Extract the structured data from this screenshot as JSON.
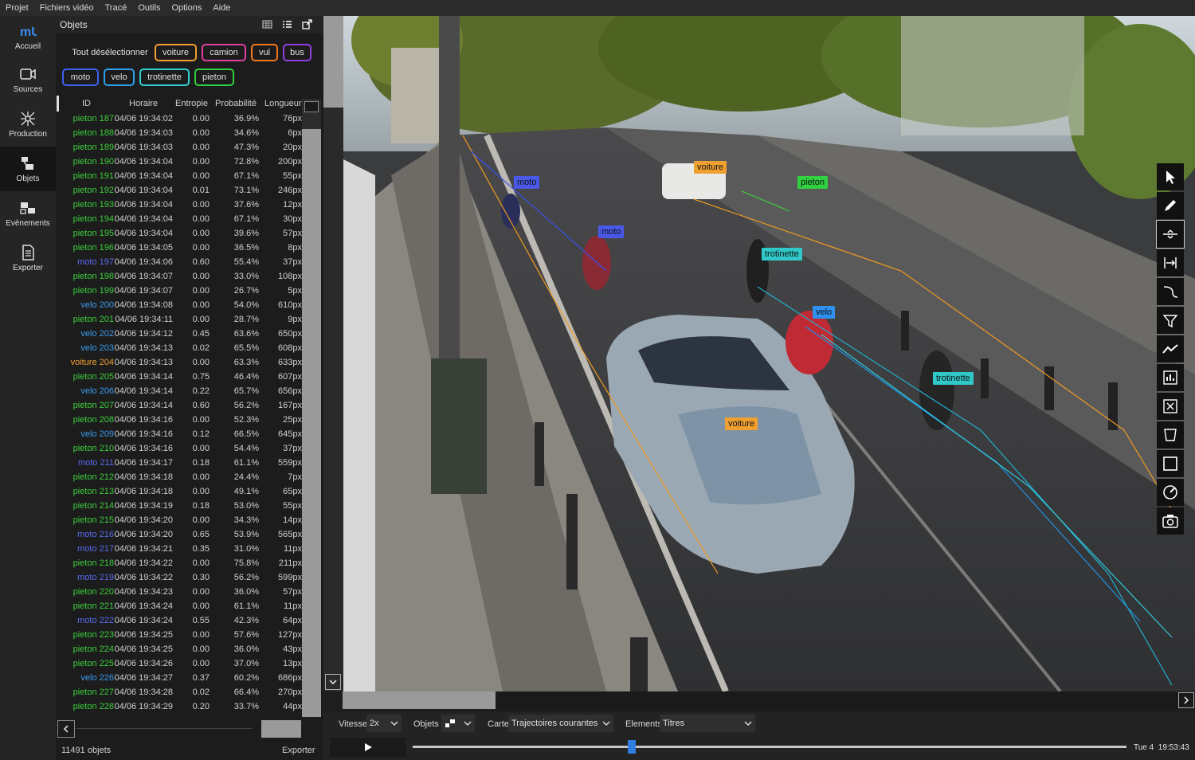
{
  "menu": [
    "Projet",
    "Fichiers vidéo",
    "Tracé",
    "Outils",
    "Options",
    "Aide"
  ],
  "nav": [
    {
      "label": "Accueil",
      "icon": "mu-logo-icon"
    },
    {
      "label": "Sources",
      "icon": "camera-icon"
    },
    {
      "label": "Production",
      "icon": "network-icon"
    },
    {
      "label": "Objets",
      "icon": "objects-icon"
    },
    {
      "label": "Evènements",
      "icon": "events-icon"
    },
    {
      "label": "Exporter",
      "icon": "document-icon"
    }
  ],
  "panel": {
    "title": "Objets",
    "deselect": "Tout désélectionner",
    "footer_count": "11491 objets",
    "export": "Exporter"
  },
  "filters": [
    {
      "label": "voiture",
      "color": "#f0a030"
    },
    {
      "label": "camion",
      "color": "#e040a0"
    },
    {
      "label": "vul",
      "color": "#f07820"
    },
    {
      "label": "bus",
      "color": "#9040e0"
    },
    {
      "label": "moto",
      "color": "#4060f0"
    },
    {
      "label": "velo",
      "color": "#30a0f0"
    },
    {
      "label": "trotinette",
      "color": "#30d0d0"
    },
    {
      "label": "pieton",
      "color": "#30d040"
    }
  ],
  "columns": [
    "ID",
    "Horaire",
    "Entropie",
    "Probabilité",
    "Longueur"
  ],
  "type_colors": {
    "pieton": "#3ccf3c",
    "moto": "#5a6cf0",
    "velo": "#3a9cf0",
    "voiture": "#f0a030"
  },
  "rows": [
    [
      "pieton 187",
      "04/06 19:34:02",
      "0.00",
      "36.9%",
      "76px"
    ],
    [
      "pieton 188",
      "04/06 19:34:03",
      "0.00",
      "34.6%",
      "6px"
    ],
    [
      "pieton 189",
      "04/06 19:34:03",
      "0.00",
      "47.3%",
      "20px"
    ],
    [
      "pieton 190",
      "04/06 19:34:04",
      "0.00",
      "72.8%",
      "200px"
    ],
    [
      "pieton 191",
      "04/06 19:34:04",
      "0.00",
      "67.1%",
      "55px"
    ],
    [
      "pieton 192",
      "04/06 19:34:04",
      "0.01",
      "73.1%",
      "246px"
    ],
    [
      "pieton 193",
      "04/06 19:34:04",
      "0.00",
      "37.6%",
      "12px"
    ],
    [
      "pieton 194",
      "04/06 19:34:04",
      "0.00",
      "67.1%",
      "30px"
    ],
    [
      "pieton 195",
      "04/06 19:34:04",
      "0.00",
      "39.6%",
      "57px"
    ],
    [
      "pieton 196",
      "04/06 19:34:05",
      "0.00",
      "36.5%",
      "8px"
    ],
    [
      "moto 197",
      "04/06 19:34:06",
      "0.60",
      "55.4%",
      "37px"
    ],
    [
      "pieton 198",
      "04/06 19:34:07",
      "0.00",
      "33.0%",
      "108px"
    ],
    [
      "pieton 199",
      "04/06 19:34:07",
      "0.00",
      "26.7%",
      "5px"
    ],
    [
      "velo 200",
      "04/06 19:34:08",
      "0.00",
      "54.0%",
      "610px"
    ],
    [
      "pieton 201",
      "04/06 19:34:11",
      "0.00",
      "28.7%",
      "9px"
    ],
    [
      "velo 202",
      "04/06 19:34:12",
      "0.45",
      "63.6%",
      "650px"
    ],
    [
      "velo 203",
      "04/06 19:34:13",
      "0.02",
      "65.5%",
      "608px"
    ],
    [
      "voiture 204",
      "04/06 19:34:13",
      "0.00",
      "63.3%",
      "633px"
    ],
    [
      "pieton 205",
      "04/06 19:34:14",
      "0.75",
      "46.4%",
      "607px"
    ],
    [
      "velo 206",
      "04/06 19:34:14",
      "0.22",
      "65.7%",
      "656px"
    ],
    [
      "pieton 207",
      "04/06 19:34:14",
      "0.60",
      "56.2%",
      "167px"
    ],
    [
      "pieton 208",
      "04/06 19:34:16",
      "0.00",
      "52.3%",
      "25px"
    ],
    [
      "velo 209",
      "04/06 19:34:16",
      "0.12",
      "66.5%",
      "645px"
    ],
    [
      "pieton 210",
      "04/06 19:34:16",
      "0.00",
      "54.4%",
      "37px"
    ],
    [
      "moto 211",
      "04/06 19:34:17",
      "0.18",
      "61.1%",
      "559px"
    ],
    [
      "pieton 212",
      "04/06 19:34:18",
      "0.00",
      "24.4%",
      "7px"
    ],
    [
      "pieton 213",
      "04/06 19:34:18",
      "0.00",
      "49.1%",
      "65px"
    ],
    [
      "pieton 214",
      "04/06 19:34:19",
      "0.18",
      "53.0%",
      "55px"
    ],
    [
      "pieton 215",
      "04/06 19:34:20",
      "0.00",
      "34.3%",
      "14px"
    ],
    [
      "moto 216",
      "04/06 19:34:20",
      "0.65",
      "53.9%",
      "565px"
    ],
    [
      "moto 217",
      "04/06 19:34:21",
      "0.35",
      "31.0%",
      "11px"
    ],
    [
      "pieton 218",
      "04/06 19:34:22",
      "0.00",
      "75.8%",
      "211px"
    ],
    [
      "moto 219",
      "04/06 19:34:22",
      "0.30",
      "56.2%",
      "599px"
    ],
    [
      "pieton 220",
      "04/06 19:34:23",
      "0.00",
      "36.0%",
      "57px"
    ],
    [
      "pieton 221",
      "04/06 19:34:24",
      "0.00",
      "61.1%",
      "11px"
    ],
    [
      "moto 222",
      "04/06 19:34:24",
      "0.55",
      "42.3%",
      "64px"
    ],
    [
      "pieton 223",
      "04/06 19:34:25",
      "0.00",
      "57.6%",
      "127px"
    ],
    [
      "pieton 224",
      "04/06 19:34:25",
      "0.00",
      "36.0%",
      "43px"
    ],
    [
      "pieton 225",
      "04/06 19:34:26",
      "0.00",
      "37.0%",
      "13px"
    ],
    [
      "velo 226",
      "04/06 19:34:27",
      "0.37",
      "60.2%",
      "686px"
    ],
    [
      "pieton 227",
      "04/06 19:34:28",
      "0.02",
      "66.4%",
      "270px"
    ],
    [
      "pieton 228",
      "04/06 19:34:29",
      "0.20",
      "33.7%",
      "44px"
    ]
  ],
  "video_labels": [
    {
      "text": "moto",
      "color": "#4a58e8"
    },
    {
      "text": "moto",
      "color": "#4a58e8"
    },
    {
      "text": "voiture",
      "color": "#f0a030"
    },
    {
      "text": "pieton",
      "color": "#30d040"
    },
    {
      "text": "trotinette",
      "color": "#30c8c8"
    },
    {
      "text": "velo",
      "color": "#3090f0"
    },
    {
      "text": "trotinette",
      "color": "#30c8c8"
    },
    {
      "text": "voiture",
      "color": "#f0a030"
    }
  ],
  "controls": {
    "speed_label": "Vitesse",
    "speed_value": "2x",
    "objects_label": "Objets",
    "map_label": "Carte",
    "map_value": "Trajectoires courantes",
    "elements_label": "Elements",
    "elements_value": "Titres",
    "timestamp": "Tue 4  19:53:43"
  },
  "progress": 0.307,
  "tools": [
    "pointer-icon",
    "pencil-icon",
    "line-icon",
    "bracket-icon",
    "curve-icon",
    "funnel-icon",
    "trend-icon",
    "chart-box-icon",
    "cross-box-icon",
    "zone-icon",
    "select-rect-icon",
    "gauge-icon",
    "screenshot-icon"
  ]
}
